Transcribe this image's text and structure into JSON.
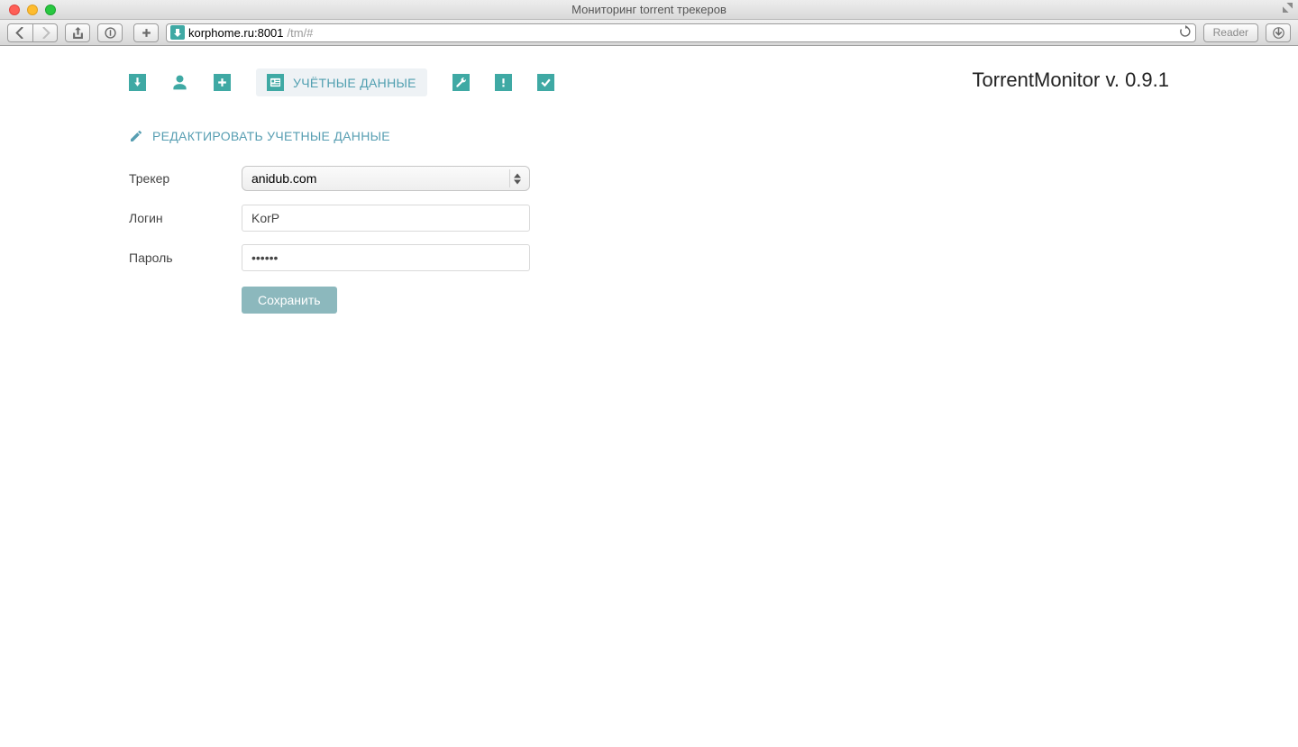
{
  "window": {
    "title": "Мониторинг torrent трекеров"
  },
  "browser": {
    "reader_label": "Reader",
    "url_host": "korphome.ru:8001",
    "url_path": "/tm/#"
  },
  "app": {
    "title": "TorrentMonitor v. 0.9.1"
  },
  "nav": {
    "active_label": "УЧЁТНЫЕ ДАННЫЕ"
  },
  "section": {
    "title": "РЕДАКТИРОВАТЬ УЧЕТНЫЕ ДАННЫЕ"
  },
  "form": {
    "tracker_label": "Трекер",
    "tracker_value": "anidub.com",
    "login_label": "Логин",
    "login_value": "KorP",
    "password_label": "Пароль",
    "password_value": "••••••",
    "save_label": "Сохранить"
  }
}
